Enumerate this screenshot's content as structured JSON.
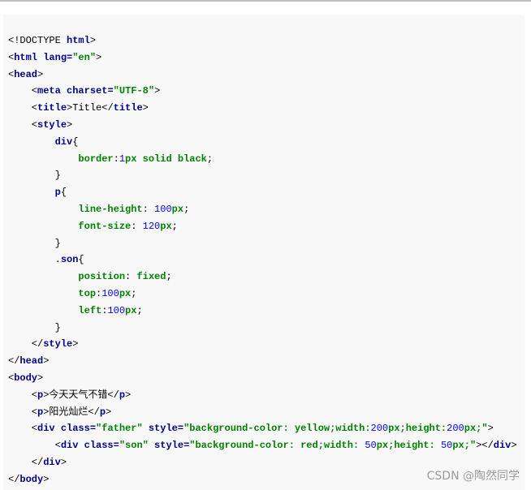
{
  "code": {
    "lines": [
      [
        {
          "t": "<!DOCTYPE ",
          "c": "plain"
        },
        {
          "t": "html",
          "c": "tag"
        },
        {
          "t": ">",
          "c": "plain"
        }
      ],
      [
        {
          "t": "<",
          "c": "plain"
        },
        {
          "t": "html",
          "c": "tag"
        },
        {
          "t": " lang=",
          "c": "attr"
        },
        {
          "t": "\"en\"",
          "c": "string"
        },
        {
          "t": ">",
          "c": "plain"
        }
      ],
      [
        {
          "t": "<",
          "c": "plain"
        },
        {
          "t": "head",
          "c": "tag"
        },
        {
          "t": ">",
          "c": "plain"
        }
      ],
      [
        {
          "t": "    <",
          "c": "plain"
        },
        {
          "t": "meta",
          "c": "tag"
        },
        {
          "t": " charset=",
          "c": "attr"
        },
        {
          "t": "\"UTF-8\"",
          "c": "string"
        },
        {
          "t": ">",
          "c": "plain"
        }
      ],
      [
        {
          "t": "    <",
          "c": "plain"
        },
        {
          "t": "title",
          "c": "tag"
        },
        {
          "t": ">Title</",
          "c": "plain"
        },
        {
          "t": "title",
          "c": "tag"
        },
        {
          "t": ">",
          "c": "plain"
        }
      ],
      [
        {
          "t": "    <",
          "c": "plain"
        },
        {
          "t": "style",
          "c": "tag"
        },
        {
          "t": ">",
          "c": "plain"
        }
      ],
      [
        {
          "t": "        ",
          "c": "plain"
        },
        {
          "t": "div",
          "c": "selector"
        },
        {
          "t": "{",
          "c": "plain"
        }
      ],
      [
        {
          "t": "            ",
          "c": "plain"
        },
        {
          "t": "border",
          "c": "prop"
        },
        {
          "t": ":",
          "c": "plain"
        },
        {
          "t": "1",
          "c": "number"
        },
        {
          "t": "px solid black",
          "c": "value"
        },
        {
          "t": ";",
          "c": "plain"
        }
      ],
      [
        {
          "t": "        }",
          "c": "plain"
        }
      ],
      [
        {
          "t": "        ",
          "c": "plain"
        },
        {
          "t": "p",
          "c": "selector"
        },
        {
          "t": "{",
          "c": "plain"
        }
      ],
      [
        {
          "t": "            ",
          "c": "plain"
        },
        {
          "t": "line-height",
          "c": "prop"
        },
        {
          "t": ": ",
          "c": "plain"
        },
        {
          "t": "100",
          "c": "number"
        },
        {
          "t": "px",
          "c": "unit"
        },
        {
          "t": ";",
          "c": "plain"
        }
      ],
      [
        {
          "t": "            ",
          "c": "plain"
        },
        {
          "t": "font-size",
          "c": "prop"
        },
        {
          "t": ": ",
          "c": "plain"
        },
        {
          "t": "120",
          "c": "number"
        },
        {
          "t": "px",
          "c": "unit"
        },
        {
          "t": ";",
          "c": "plain"
        }
      ],
      [
        {
          "t": "        }",
          "c": "plain"
        }
      ],
      [
        {
          "t": "        .",
          "c": "plain"
        },
        {
          "t": "son",
          "c": "selector"
        },
        {
          "t": "{",
          "c": "plain"
        }
      ],
      [
        {
          "t": "            ",
          "c": "plain"
        },
        {
          "t": "position",
          "c": "prop"
        },
        {
          "t": ": ",
          "c": "plain"
        },
        {
          "t": "fixed",
          "c": "value"
        },
        {
          "t": ";",
          "c": "plain"
        }
      ],
      [
        {
          "t": "            ",
          "c": "plain"
        },
        {
          "t": "top",
          "c": "prop"
        },
        {
          "t": ":",
          "c": "plain"
        },
        {
          "t": "100",
          "c": "number"
        },
        {
          "t": "px",
          "c": "unit"
        },
        {
          "t": ";",
          "c": "plain"
        }
      ],
      [
        {
          "t": "            ",
          "c": "plain"
        },
        {
          "t": "left",
          "c": "prop"
        },
        {
          "t": ":",
          "c": "plain"
        },
        {
          "t": "100",
          "c": "number"
        },
        {
          "t": "px",
          "c": "unit"
        },
        {
          "t": ";",
          "c": "plain"
        }
      ],
      [
        {
          "t": "        }",
          "c": "plain"
        }
      ],
      [
        {
          "t": "    </",
          "c": "plain"
        },
        {
          "t": "style",
          "c": "tag"
        },
        {
          "t": ">",
          "c": "plain"
        }
      ],
      [
        {
          "t": "</",
          "c": "plain"
        },
        {
          "t": "head",
          "c": "tag"
        },
        {
          "t": ">",
          "c": "plain"
        }
      ],
      [
        {
          "t": "<",
          "c": "plain"
        },
        {
          "t": "body",
          "c": "tag"
        },
        {
          "t": ">",
          "c": "plain"
        }
      ],
      [
        {
          "t": "    <",
          "c": "plain"
        },
        {
          "t": "p",
          "c": "tag"
        },
        {
          "t": ">今天天气不错</",
          "c": "plain"
        },
        {
          "t": "p",
          "c": "tag"
        },
        {
          "t": ">",
          "c": "plain"
        }
      ],
      [
        {
          "t": "    <",
          "c": "plain"
        },
        {
          "t": "p",
          "c": "tag"
        },
        {
          "t": ">阳光灿烂</",
          "c": "plain"
        },
        {
          "t": "p",
          "c": "tag"
        },
        {
          "t": ">",
          "c": "plain"
        }
      ],
      [
        {
          "t": "    <",
          "c": "plain"
        },
        {
          "t": "div",
          "c": "tag"
        },
        {
          "t": " class=",
          "c": "attr"
        },
        {
          "t": "\"father\"",
          "c": "string"
        },
        {
          "t": " style=",
          "c": "attr"
        },
        {
          "t": "\"background-color: yellow;width:",
          "c": "string"
        },
        {
          "t": "200",
          "c": "number"
        },
        {
          "t": "px;height:",
          "c": "string"
        },
        {
          "t": "200",
          "c": "number"
        },
        {
          "t": "px;\"",
          "c": "string"
        },
        {
          "t": ">",
          "c": "plain"
        }
      ],
      [
        {
          "t": "        <",
          "c": "plain"
        },
        {
          "t": "div",
          "c": "tag"
        },
        {
          "t": " class=",
          "c": "attr"
        },
        {
          "t": "\"son\"",
          "c": "string"
        },
        {
          "t": " style=",
          "c": "attr"
        },
        {
          "t": "\"background-color: red;width: ",
          "c": "string"
        },
        {
          "t": "50",
          "c": "number"
        },
        {
          "t": "px;height: ",
          "c": "string"
        },
        {
          "t": "50",
          "c": "number"
        },
        {
          "t": "px;\"",
          "c": "string"
        },
        {
          "t": "></",
          "c": "plain"
        },
        {
          "t": "div",
          "c": "tag"
        },
        {
          "t": ">",
          "c": "plain"
        }
      ],
      [
        {
          "t": "    </",
          "c": "plain"
        },
        {
          "t": "div",
          "c": "tag"
        },
        {
          "t": ">",
          "c": "plain"
        }
      ],
      [
        {
          "t": "</",
          "c": "plain"
        },
        {
          "t": "body",
          "c": "tag"
        },
        {
          "t": ">",
          "c": "plain"
        }
      ],
      [
        {
          "t": "</",
          "c": "plain"
        },
        {
          "t": "html",
          "c": "tag"
        },
        {
          "t": ">",
          "c": "plain"
        }
      ]
    ]
  },
  "watermark": {
    "text": "CSDN @陶然同学"
  }
}
